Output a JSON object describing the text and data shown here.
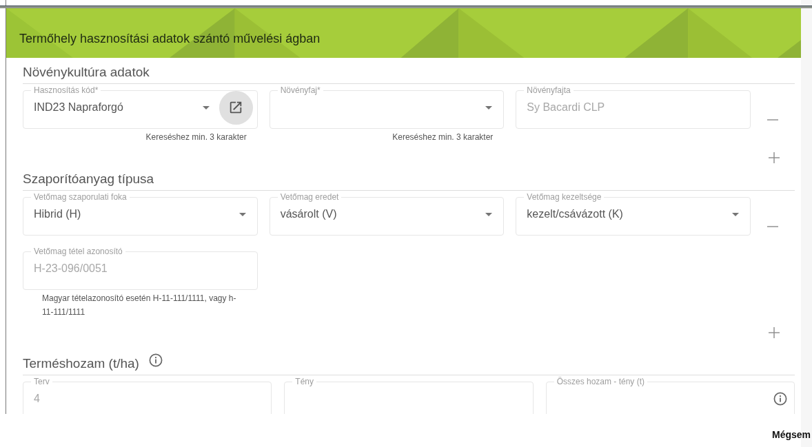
{
  "dialog": {
    "title": "Termőhely hasznosítási adatok szántó művelési ágban"
  },
  "sections": [
    {
      "title": "Növénykultúra adatok",
      "row_actions": true,
      "rows": [
        [
          {
            "kind": "select",
            "label": "Hasznosítás kód*",
            "value": "IND23 Napraforgó",
            "disabled": false,
            "link_button": true,
            "hint": "Kereséshez min. 3 karakter"
          },
          {
            "kind": "select",
            "label": "Növényfaj*",
            "hint": "Kereséshez min. 3 karakter"
          },
          {
            "kind": "text",
            "label": "Növényfajta",
            "value": "Sy Bacardi CLP",
            "disabled": true
          }
        ]
      ]
    },
    {
      "title": "Szaporítóanyag típusa",
      "row_actions": true,
      "rows": [
        [
          {
            "kind": "select",
            "label": "Vetőmag szaporulati foka",
            "value": "Hibrid (H)",
            "disabled": false
          },
          {
            "kind": "select",
            "label": "Vetőmag eredet",
            "value": "vásárolt (V)",
            "disabled": false
          },
          {
            "kind": "select",
            "label": "Vetőmag kezeltsége",
            "value": "kezelt/csávázott (K)",
            "disabled": false
          }
        ],
        [
          {
            "kind": "text",
            "label": "Vetőmag tétel azonosító",
            "value": "H-23-096/0051",
            "disabled": true,
            "hint": "Magyar tételazonosító esetén H-11-111/1111, vagy h-11-111/1111"
          }
        ]
      ]
    },
    {
      "title": "Terméshozam (t/ha)",
      "info": true,
      "row_actions": false,
      "rows": [
        [
          {
            "kind": "text",
            "label": "Terv",
            "value": "4",
            "disabled": true
          },
          {
            "kind": "text",
            "label": "Tény"
          },
          {
            "kind": "text",
            "label": "Összes hozam - tény (t)",
            "info": true
          }
        ]
      ]
    }
  ],
  "footer": {
    "cancel_button": "Mégsem"
  }
}
